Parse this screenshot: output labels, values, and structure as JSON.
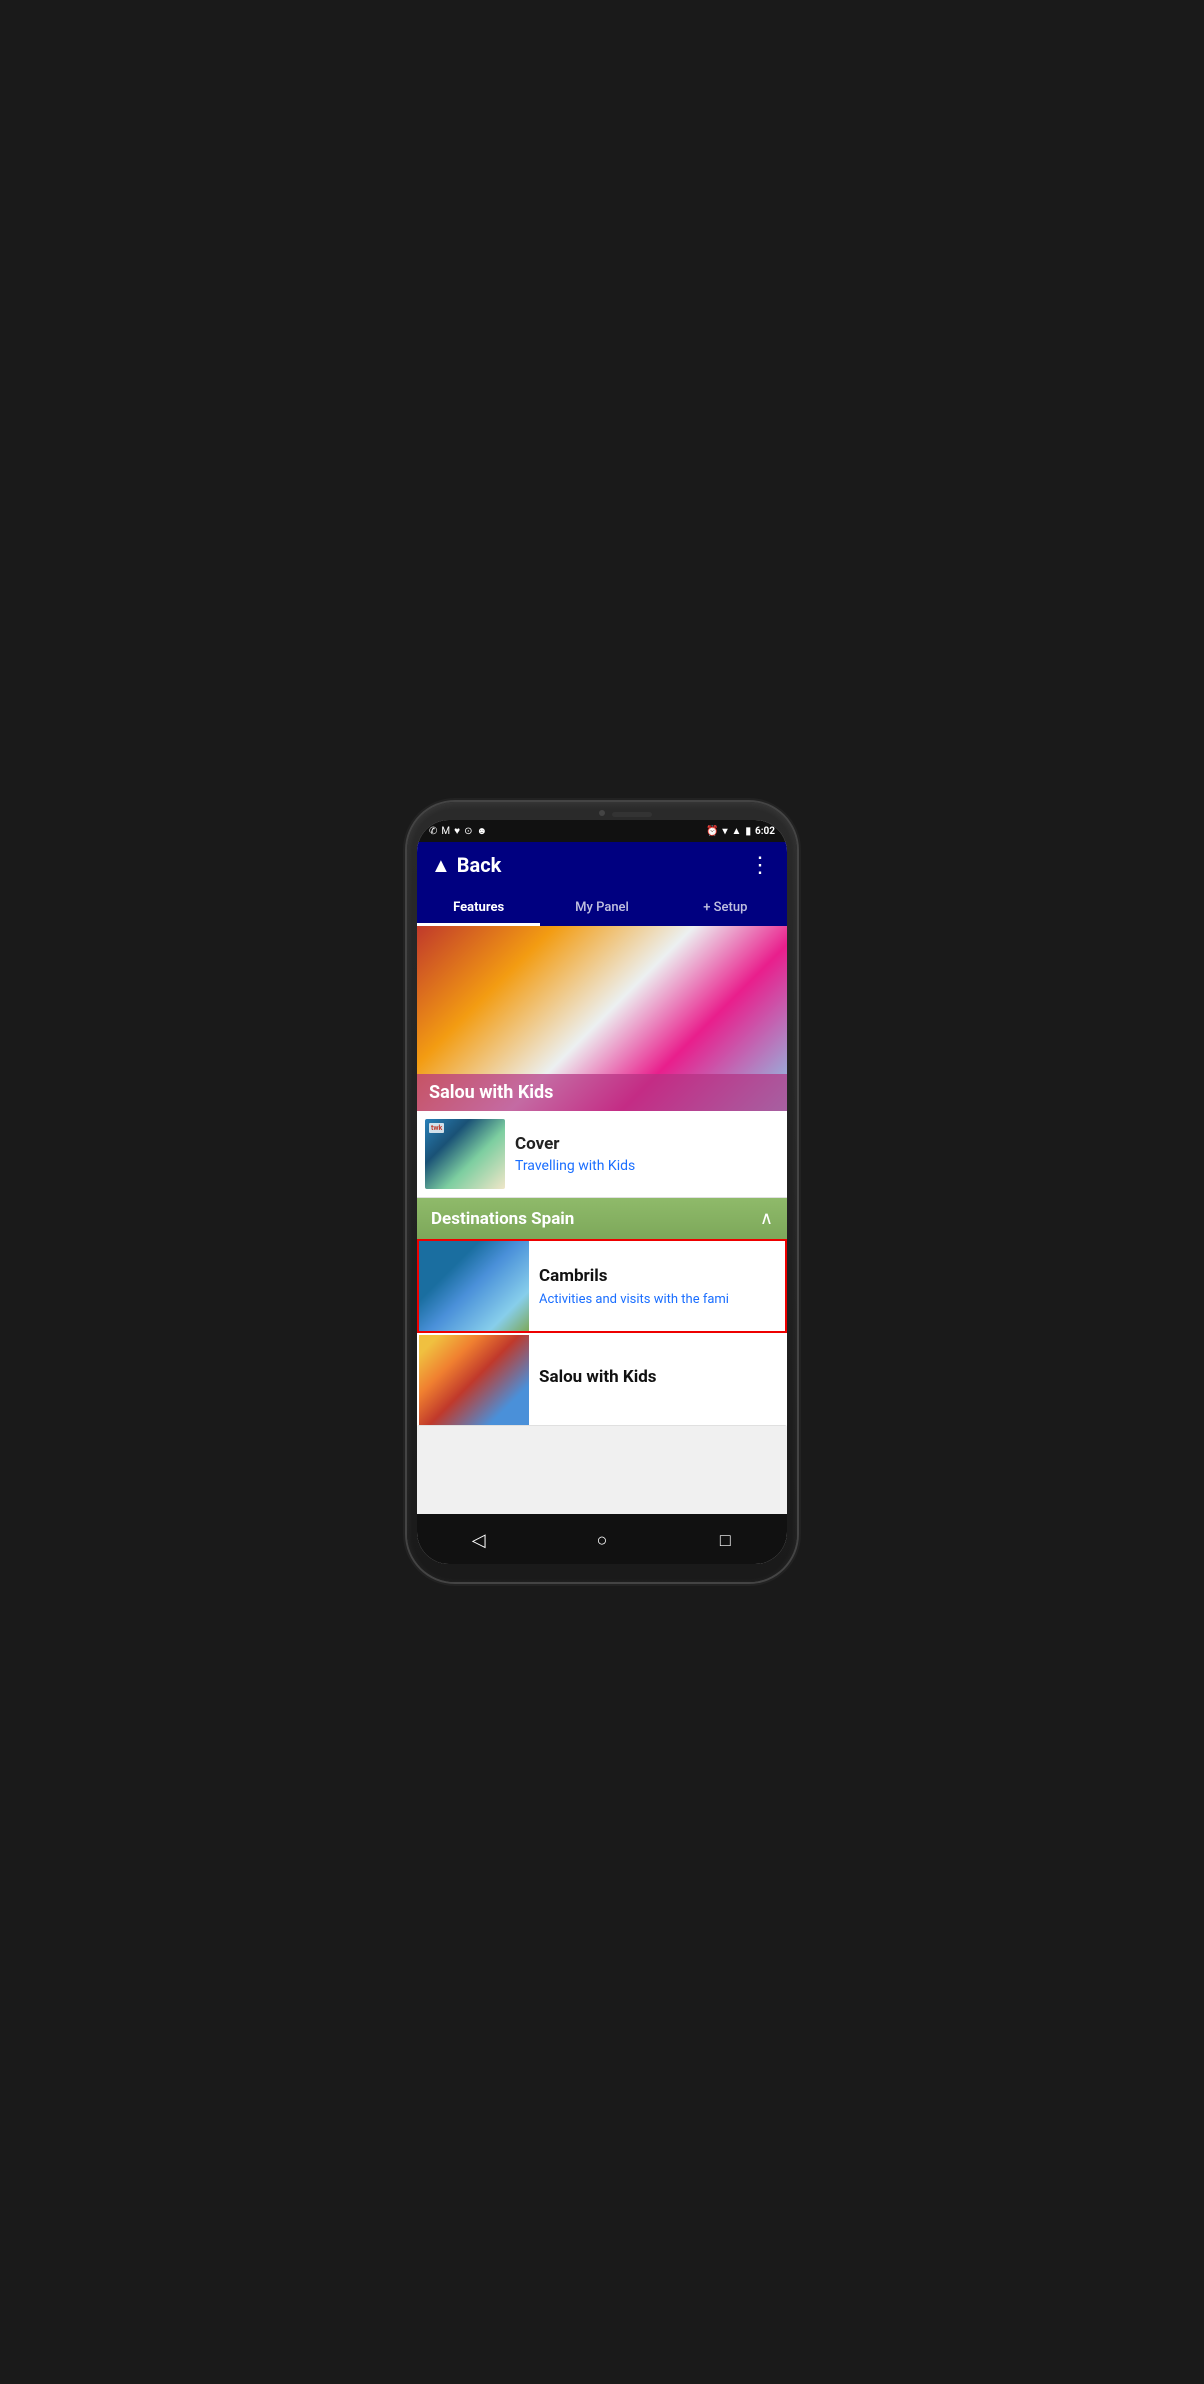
{
  "statusBar": {
    "time": "6:02",
    "icons": [
      "whatsapp",
      "gmail",
      "heart",
      "security",
      "android"
    ]
  },
  "appBar": {
    "backLabel": "Back",
    "moreIcon": "⋮"
  },
  "tabs": [
    {
      "id": "features",
      "label": "Features",
      "active": true
    },
    {
      "id": "mypanel",
      "label": "My Panel",
      "active": false
    },
    {
      "id": "setup",
      "label": "+ Setup",
      "active": false
    }
  ],
  "hero": {
    "title": "Salou with Kids"
  },
  "coverRow": {
    "label": "twk",
    "title": "Cover",
    "subtitle": "Travelling with Kids"
  },
  "destinationsSection": {
    "title": "Destinations Spain",
    "collapsed": false
  },
  "listItems": [
    {
      "id": "cambrils",
      "title": "Cambrils",
      "subtitle": "Activities and visits with the fami",
      "selected": true
    },
    {
      "id": "salou",
      "title": "Salou with Kids",
      "subtitle": "",
      "selected": false
    }
  ],
  "bottomNav": {
    "backIcon": "◁",
    "homeIcon": "○",
    "recentIcon": "□"
  }
}
